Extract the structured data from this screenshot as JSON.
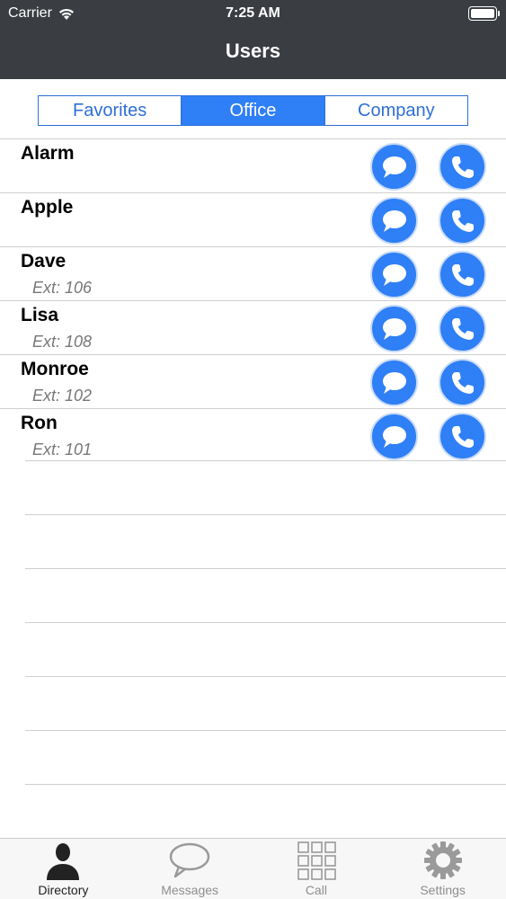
{
  "status": {
    "carrier": "Carrier",
    "time": "7:25 AM"
  },
  "header": {
    "title": "Users"
  },
  "segments": [
    {
      "label": "Favorites",
      "active": false
    },
    {
      "label": "Office",
      "active": true
    },
    {
      "label": "Company",
      "active": false
    }
  ],
  "users": [
    {
      "name": "Alarm",
      "ext": ""
    },
    {
      "name": "Apple",
      "ext": ""
    },
    {
      "name": "Dave",
      "ext": "Ext: 106"
    },
    {
      "name": "Lisa",
      "ext": "Ext: 108"
    },
    {
      "name": "Monroe",
      "ext": "Ext: 102"
    },
    {
      "name": "Ron",
      "ext": "Ext: 101"
    }
  ],
  "tabs": [
    {
      "label": "Directory",
      "icon": "person-icon",
      "active": true
    },
    {
      "label": "Messages",
      "icon": "speech-bubble-icon",
      "active": false
    },
    {
      "label": "Call",
      "icon": "keypad-icon",
      "active": false
    },
    {
      "label": "Settings",
      "icon": "gear-icon",
      "active": false
    }
  ],
  "colors": {
    "accent": "#2f7ff6",
    "topbar": "#3a3d42"
  }
}
